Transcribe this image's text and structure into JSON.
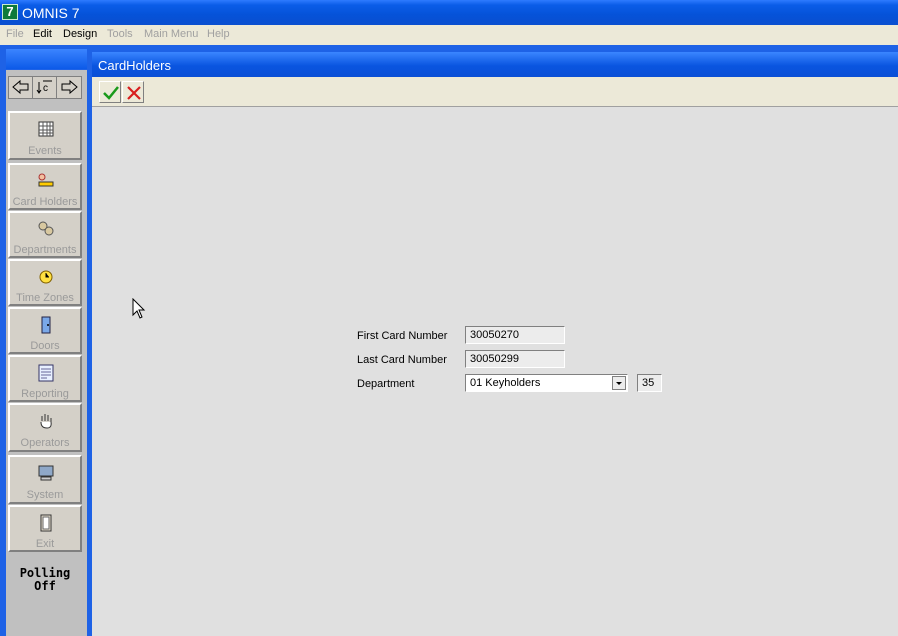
{
  "app": {
    "icon_glyph": "7",
    "title": "OMNIS 7"
  },
  "menu": [
    {
      "label": "File",
      "enabled": false
    },
    {
      "label": "Edit",
      "enabled": true
    },
    {
      "label": "Design",
      "enabled": true
    },
    {
      "label": "Tools",
      "enabled": false
    },
    {
      "label": "Main Menu",
      "enabled": false
    },
    {
      "label": "Help",
      "enabled": false
    }
  ],
  "nav": {
    "icons": [
      "arrow-left-icon",
      "reload-c-icon",
      "arrow-right-icon"
    ]
  },
  "sidebar": {
    "items": [
      {
        "label": "Events",
        "icon": "events-grid-icon"
      },
      {
        "label": "Card Holders",
        "icon": "card-holder-icon"
      },
      {
        "label": "Departments",
        "icon": "departments-icon"
      },
      {
        "label": "Time Zones",
        "icon": "clock-icon"
      },
      {
        "label": "Doors",
        "icon": "door-icon"
      },
      {
        "label": "Reporting",
        "icon": "report-icon"
      },
      {
        "label": "Operators",
        "icon": "hand-icon"
      },
      {
        "label": "System",
        "icon": "computer-icon"
      },
      {
        "label": "Exit",
        "icon": "exit-door-icon"
      }
    ],
    "polling_line1": "Polling",
    "polling_line2": "Off"
  },
  "window": {
    "title": "CardHolders"
  },
  "toolbar": {
    "icons": [
      "checkmark-icon",
      "cancel-x-icon"
    ]
  },
  "form": {
    "first_card_label": "First Card Number",
    "first_card_value": "30050270",
    "last_card_label": "Last Card Number",
    "last_card_value": "30050299",
    "department_label": "Department",
    "department_value": "01 Keyholders",
    "department_count": "35"
  },
  "colors": {
    "title_blue": "#0a55e0",
    "menu_bg": "#ece9d8",
    "content_bg": "#e0e0e0",
    "check_green": "#1a9a1a",
    "x_red": "#d81e1e"
  }
}
